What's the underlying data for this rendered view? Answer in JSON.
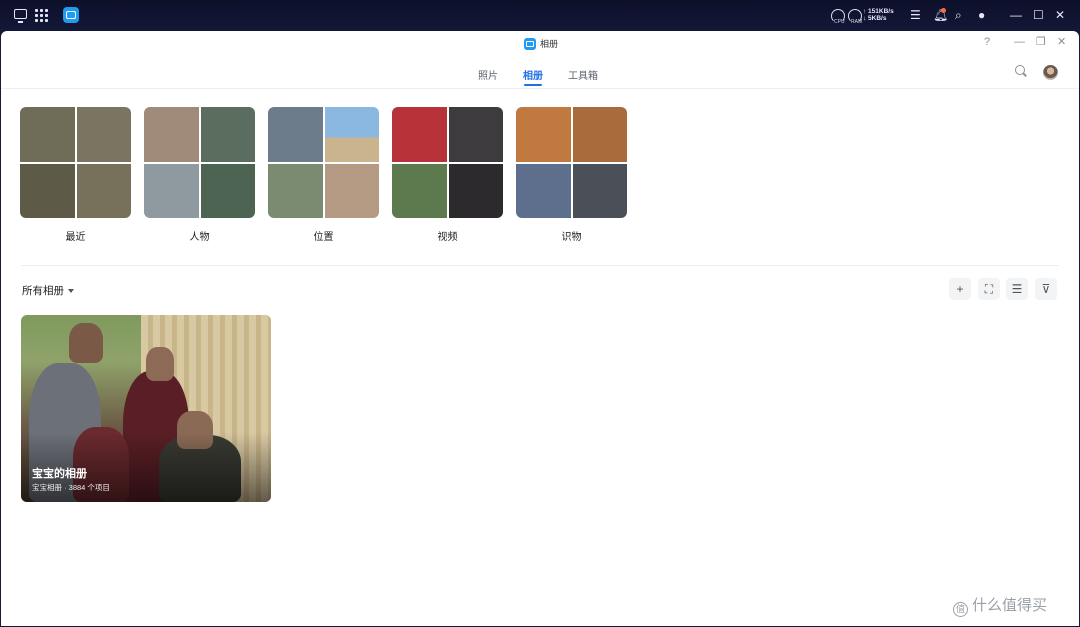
{
  "sysbar": {
    "cpu_label": "CPU",
    "ram_label": "RAM",
    "upload": "↑ 151KB/s",
    "download": "↓ 5KB/s"
  },
  "window": {
    "title": "相册",
    "help": "?",
    "minimize": "—",
    "restore": "❐",
    "close": "✕"
  },
  "tabs": [
    {
      "label": "照片"
    },
    {
      "label": "相册"
    },
    {
      "label": "工具箱"
    }
  ],
  "categories": [
    {
      "label": "最近"
    },
    {
      "label": "人物"
    },
    {
      "label": "位置"
    },
    {
      "label": "视频"
    },
    {
      "label": "识物"
    }
  ],
  "albums_section": {
    "heading": "所有相册",
    "tools": {
      "add": "+",
      "select": "⛶",
      "sort": "☰",
      "filter": "⊽"
    }
  },
  "album": {
    "title": "宝宝的相册",
    "subtitle": "宝宝相册 · 3884 个项目"
  },
  "watermark": {
    "icon": "值",
    "text": "什么值得买"
  },
  "colors": {
    "accent": "#1f6fe5",
    "app_icon": "#1f9bf0",
    "desktop_bg": "#161a3a"
  }
}
